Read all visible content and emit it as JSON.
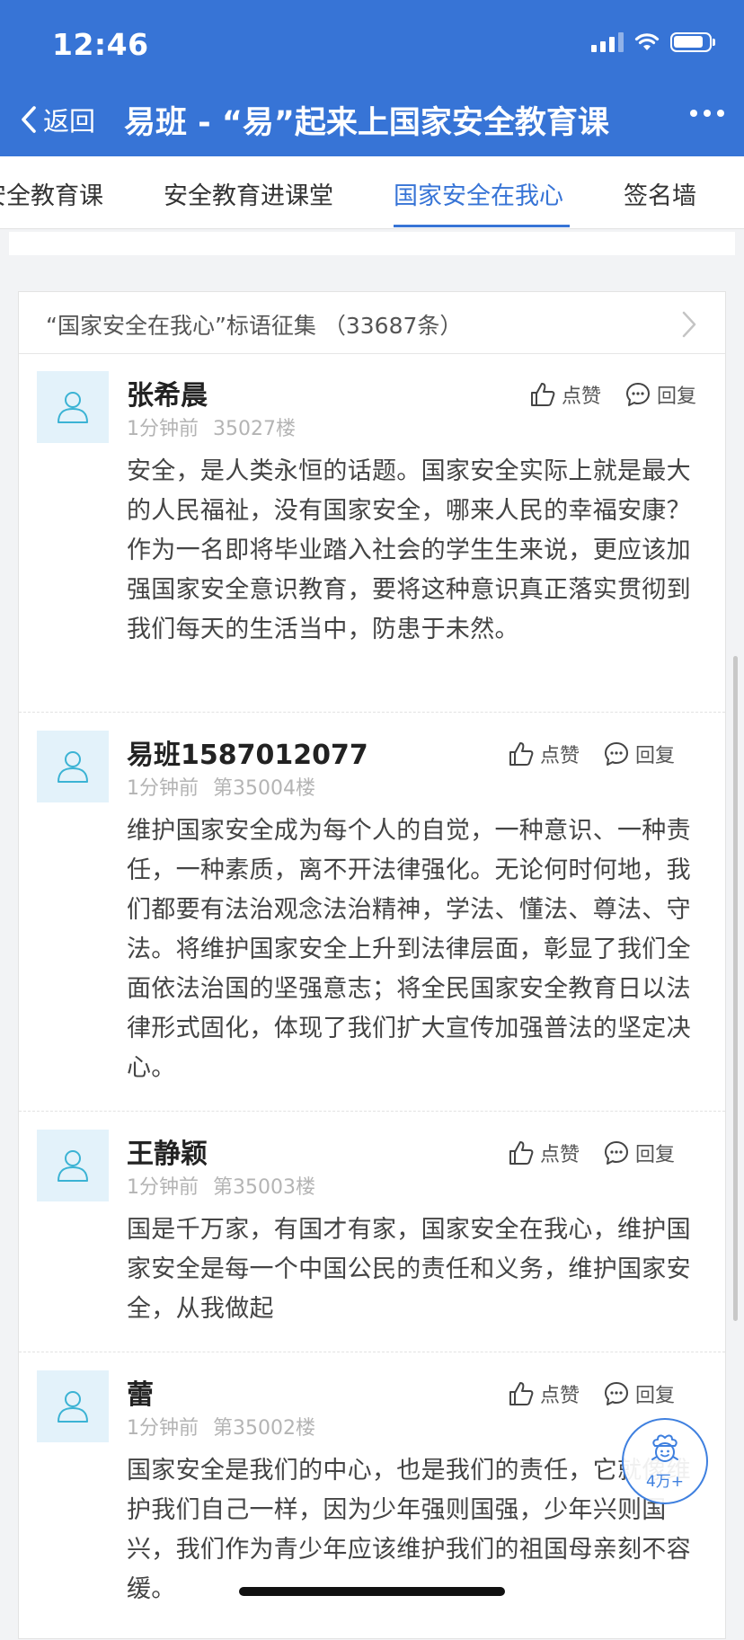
{
  "status_bar": {
    "time": "12:46"
  },
  "nav": {
    "back_label": "返回",
    "title": "易班 - “易”起来上国家安全教育课"
  },
  "tabs": [
    {
      "label": "安全教育课"
    },
    {
      "label": "安全教育进课堂"
    },
    {
      "label": "国家安全在我心"
    },
    {
      "label": "签名墙"
    }
  ],
  "active_tab": "国家安全在我心",
  "card": {
    "header": "“国家安全在我心”标语征集 （33687条）"
  },
  "actions": {
    "like_label": "点赞",
    "reply_label": "回复"
  },
  "comments": [
    {
      "name": "张希晨",
      "time": "1分钟前",
      "floor": "35027楼",
      "text": "安全，是人类永恒的话题。国家安全实际上就是最大的人民福祉，没有国家安全，哪来人民的幸福安康？作为一名即将毕业踏入社会的学生生来说，更应该加强国家安全意识教育，要将这种意识真正落实贯彻到我们每天的生活当中，防患于未然。"
    },
    {
      "name": "易班1587012077",
      "time": "1分钟前",
      "floor": "第35004楼",
      "text": "维护国家安全成为每个人的自觉，一种意识、一种责任，一种素质，离不开法律强化。无论何时何地，我们都要有法治观念法治精神，学法、懂法、尊法、守法。将维护国家安全上升到法律层面，彰显了我们全面依法治国的坚强意志；将全民国家安全教育日以法律形式固化，体现了我们扩大宣传加强普法的坚定决心。"
    },
    {
      "name": "王静颖",
      "time": "1分钟前",
      "floor": "第35003楼",
      "text": "国是千万家，有国才有家，国家安全在我心，维护国家安全是每一个中国公民的责任和义务，维护国家安全，从我做起"
    },
    {
      "name": "蕾",
      "time": "1分钟前",
      "floor": "第35002楼",
      "text": "国家安全是我们的中心，也是我们的责任，它就像维护我们自己一样，因为少年强则国强，少年兴则国兴，我们作为青少年应该维护我们的祖国母亲刻不容缓。"
    }
  ],
  "float_badge": {
    "count": "4万+"
  },
  "colors": {
    "primary": "#3774d6",
    "avatar_bg": "#e3f2fa",
    "avatar_icon": "#3bb3d4"
  }
}
